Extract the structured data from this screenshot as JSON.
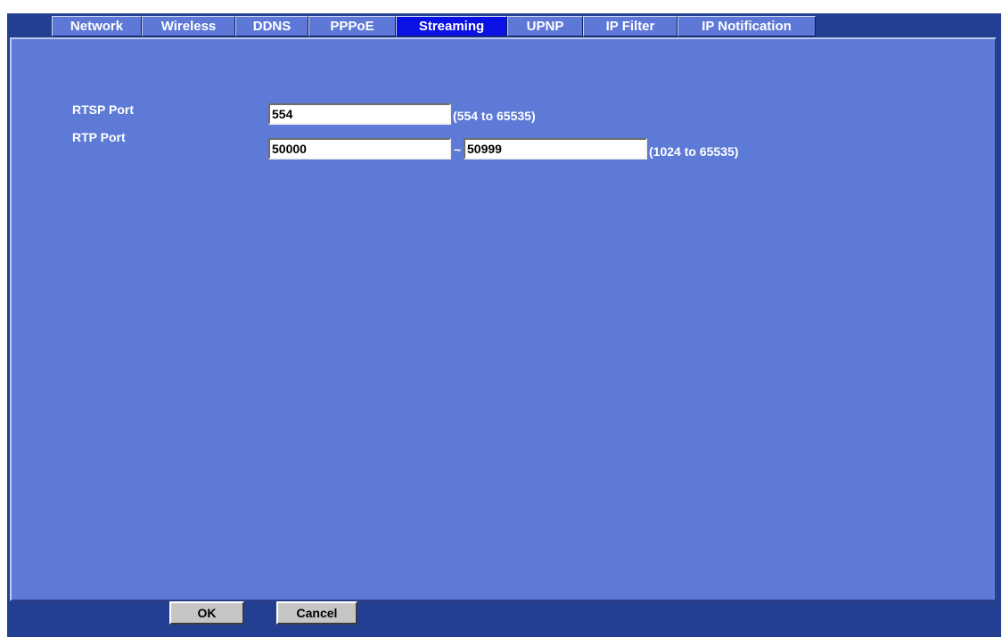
{
  "tabs": [
    {
      "label": "Network",
      "active": false
    },
    {
      "label": "Wireless",
      "active": false
    },
    {
      "label": "DDNS",
      "active": false
    },
    {
      "label": "PPPoE",
      "active": false
    },
    {
      "label": "Streaming",
      "active": true
    },
    {
      "label": "UPNP",
      "active": false
    },
    {
      "label": "IP Filter",
      "active": false
    },
    {
      "label": "IP Notification",
      "active": false
    }
  ],
  "streaming": {
    "rtsp": {
      "label": "RTSP Port",
      "value": "554",
      "range": "(554 to 65535)"
    },
    "rtp": {
      "label": "RTP Port",
      "start": "50000",
      "separator": "~",
      "end": "50999",
      "range": "(1024 to 65535)"
    }
  },
  "buttons": {
    "ok": "OK",
    "cancel": "Cancel"
  },
  "colors": {
    "frame": "#233f91",
    "panel": "#5d7bd6",
    "tab": "#5d78d6",
    "active_tab": "#0b12e6",
    "button": "#c6c6c6"
  }
}
